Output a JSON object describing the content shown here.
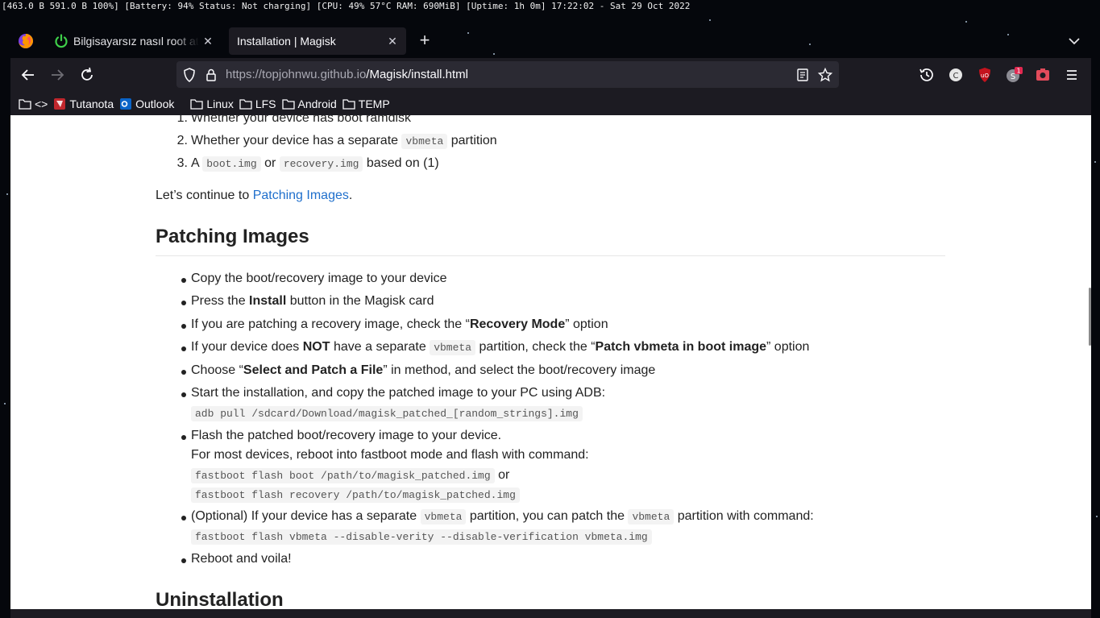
{
  "statusbar": {
    "text": "[463.0 B 591.0 B 100%] [Battery: 94% Status: Not charging] [CPU: 49% 57°C RAM: 690MiB] [Uptime: 1h 0m] 17:22:02 - Sat 29 Oct 2022"
  },
  "tabs": [
    {
      "title": "Bilgisayarsız nasıl root atılır",
      "icon": "power-icon",
      "active": false
    },
    {
      "title": "Installation | Magisk",
      "icon": "none",
      "active": true
    }
  ],
  "url": {
    "host": "https://topjohnwu.github.io",
    "path": "/Magisk/install.html"
  },
  "bookmarks": [
    {
      "label": "<>",
      "icon": "folder-icon"
    },
    {
      "label": "Tutanota",
      "icon": "tutanota-icon"
    },
    {
      "label": "Outlook",
      "icon": "outlook-icon"
    },
    {
      "label": "Linux",
      "icon": "folder-icon"
    },
    {
      "label": "LFS",
      "icon": "folder-icon"
    },
    {
      "label": "Android",
      "icon": "folder-icon"
    },
    {
      "label": "TEMP",
      "icon": "folder-icon"
    }
  ],
  "extensions": {
    "badge": "1"
  },
  "content": {
    "ol": {
      "item1": "Whether your device has boot ramdisk",
      "item2_pre": "Whether your device has a separate",
      "item2_code": "vbmeta",
      "item2_post": "partition",
      "item3_pre": "A",
      "item3_code1": "boot.img",
      "item3_mid": "or",
      "item3_code2": "recovery.img",
      "item3_post": "based on (1)"
    },
    "continue_pre": "Let’s continue to",
    "continue_link": "Patching Images",
    "continue_post": ".",
    "heading1": "Patching Images",
    "steps": {
      "s1": "Copy the boot/recovery image to your device",
      "s2_pre": "Press the",
      "s2_bold": "Install",
      "s2_post": "button in the Magisk card",
      "s3_pre": "If you are patching a recovery image, check the “",
      "s3_bold": "Recovery Mode",
      "s3_post": "” option",
      "s4_pre": "If your device does",
      "s4_bold1": "NOT",
      "s4_mid": "have a separate",
      "s4_code": "vbmeta",
      "s4_mid2": "partition, check the “",
      "s4_bold2": "Patch vbmeta in boot image",
      "s4_post": "” option",
      "s5_pre": "Choose “",
      "s5_bold": "Select and Patch a File",
      "s5_post": "” in method, and select the boot/recovery image",
      "s6": "Start the installation, and copy the patched image to your PC using ADB:",
      "s6_code": "adb pull /sdcard/Download/magisk_patched_[random_strings].img",
      "s7": "Flash the patched boot/recovery image to your device.",
      "s7_line2": "For most devices, reboot into fastboot mode and flash with command:",
      "s7_code1": "fastboot flash boot /path/to/magisk_patched.img",
      "s7_or": "or",
      "s7_code2": "fastboot flash recovery /path/to/magisk_patched.img",
      "s8_pre": "(Optional) If your device has a separate",
      "s8_code1": "vbmeta",
      "s8_mid": "partition, you can patch the",
      "s8_code2": "vbmeta",
      "s8_post": "partition with command:",
      "s8_code3": "fastboot flash vbmeta --disable-verity --disable-verification vbmeta.img",
      "s9": "Reboot and voila!"
    },
    "heading2": "Uninstallation"
  }
}
